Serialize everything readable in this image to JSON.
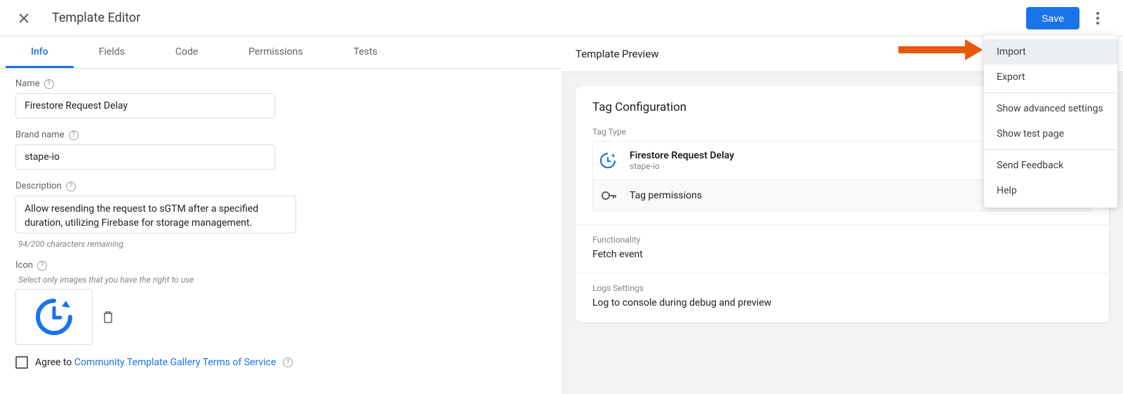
{
  "header": {
    "title": "Template Editor",
    "save_label": "Save"
  },
  "tabs": [
    {
      "label": "Info"
    },
    {
      "label": "Fields"
    },
    {
      "label": "Code"
    },
    {
      "label": "Permissions"
    },
    {
      "label": "Tests"
    }
  ],
  "form": {
    "name_label": "Name",
    "name_value": "Firestore Request Delay",
    "brand_label": "Brand name",
    "brand_value": "stape-io",
    "description_label": "Description",
    "description_value": "Allow resending the request to sGTM after a specified duration, utilizing Firebase for storage management.",
    "description_hint": "94/200 characters remaining",
    "icon_label": "Icon",
    "icon_hint": "Select only images that you have the right to use",
    "agree_prefix": "Agree to ",
    "agree_link": "Community Template Gallery Terms of Service"
  },
  "preview": {
    "header": "Template Preview",
    "config_title": "Tag Configuration",
    "tag_type_label": "Tag Type",
    "tag_name": "Firestore Request Delay",
    "tag_brand": "stape-io",
    "permissions_label": "Tag permissions",
    "functionality_label": "Functionality",
    "functionality_value": "Fetch event",
    "logs_label": "Logs Settings",
    "logs_value": "Log to console during debug and preview"
  },
  "menu": {
    "import": "Import",
    "export": "Export",
    "advanced": "Show advanced settings",
    "test_page": "Show test page",
    "feedback": "Send Feedback",
    "help": "Help"
  }
}
